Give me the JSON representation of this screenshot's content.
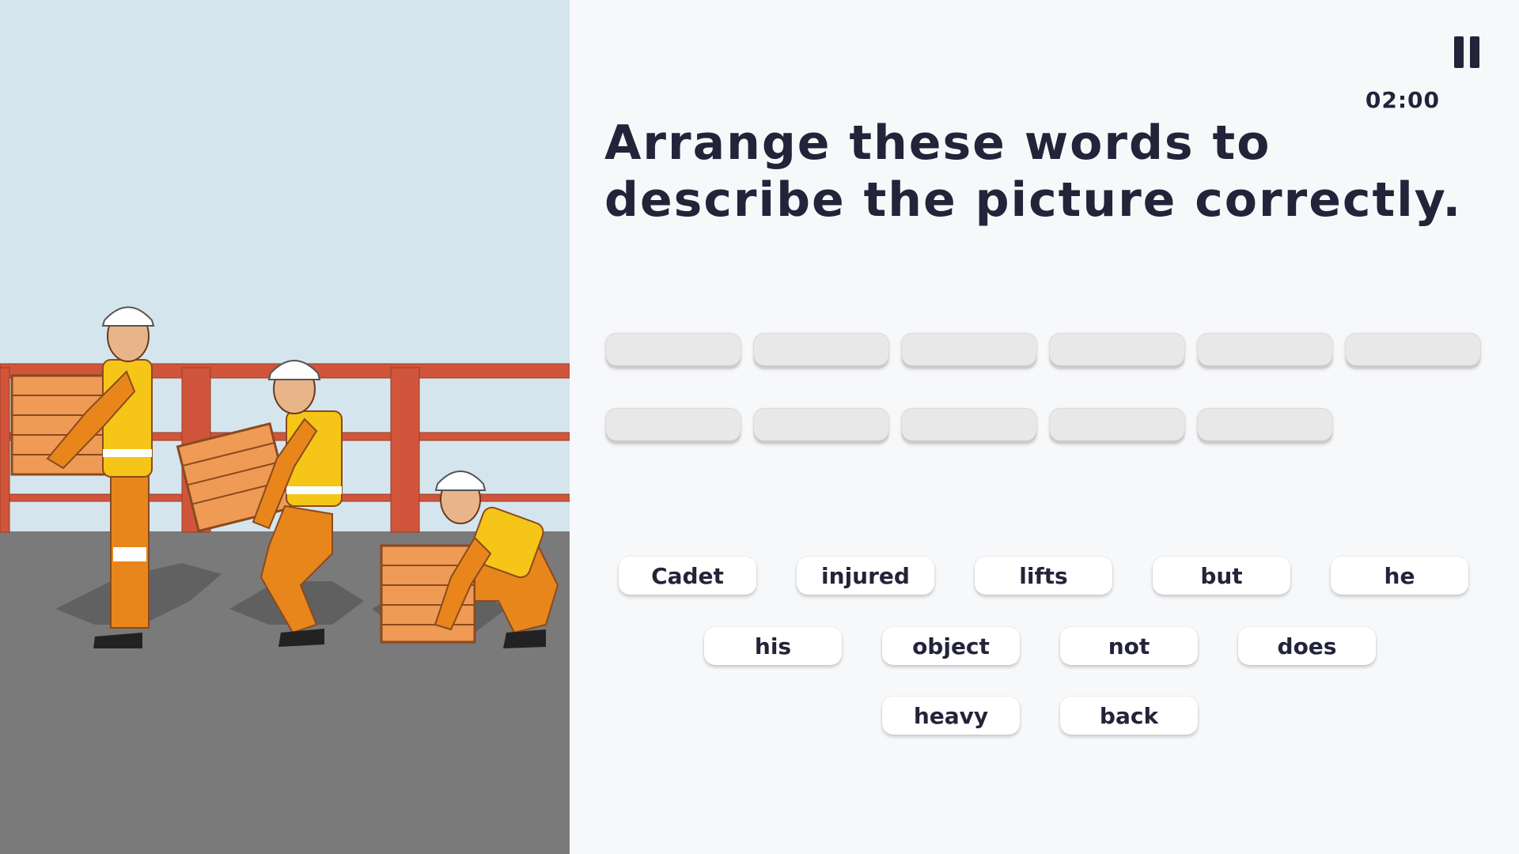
{
  "timer": "02:00",
  "title": "Arrange these words to describe the picture correctly.",
  "slot_rows": [
    6,
    5
  ],
  "word_bank": [
    "Cadet",
    "injured",
    "lifts",
    "but",
    "he",
    "his",
    "object",
    "not",
    "does",
    "heavy",
    "back"
  ],
  "icons": {
    "pause": "pause-icon"
  },
  "colors": {
    "text": "#23233a",
    "sky": "#d5e5ee",
    "railing": "#d0553a",
    "floor": "#7a7a7a",
    "uniform": "#e8861c",
    "vest": "#f5c518",
    "crate": "#ef9a55",
    "slot": "#e8e8e8",
    "chip": "#ffffff"
  }
}
